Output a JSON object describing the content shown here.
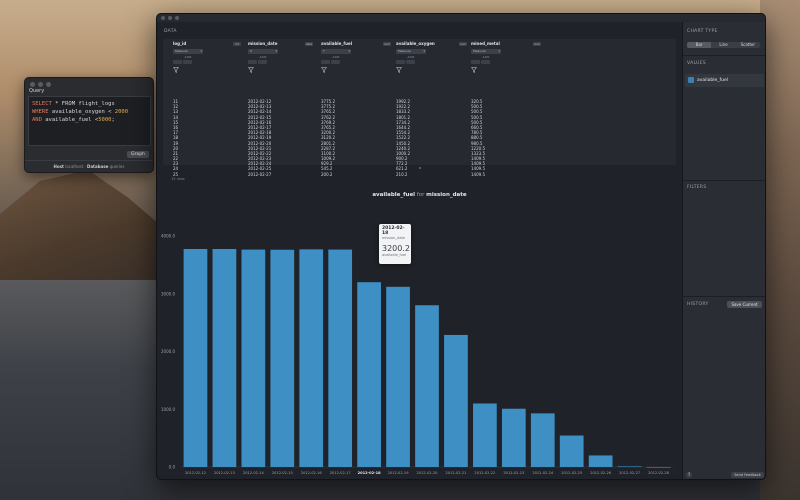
{
  "query_window": {
    "title": "Query",
    "sql_lines": [
      {
        "kw": "SELECT",
        "rest": " * FROM flight_logs"
      },
      {
        "kw": "WHERE",
        "rest": " available_oxygen < ",
        "num": "2000"
      },
      {
        "kw": "AND",
        "rest": " available_fuel <",
        "num": "5000",
        "tail": ";"
      }
    ],
    "graph_button": "Graph",
    "status": {
      "host_label": "Host",
      "host": "localhost",
      "sep": "·",
      "db_label": "Database",
      "db": "queries"
    }
  },
  "main": {
    "data_label": "DATA",
    "columns": [
      {
        "name": "log_id",
        "type": "int",
        "select": "Measure",
        "axis": "AXIS"
      },
      {
        "name": "mission_date",
        "type": "date",
        "select": "X",
        "axis": "AXIS"
      },
      {
        "name": "available_fuel",
        "type": "num",
        "select": "Y",
        "axis": "AXIS"
      },
      {
        "name": "available_oxygen",
        "type": "num",
        "select": "Measure",
        "axis": "AXIS"
      },
      {
        "name": "mined_metal",
        "type": "num",
        "select": "Measure",
        "axis": "AXIS"
      }
    ],
    "rows": [
      [
        "11",
        "2012-02-12",
        "3775.2",
        "1992.2",
        "320.5"
      ],
      [
        "12",
        "2012-02-13",
        "3775.2",
        "1922.2",
        "500.5"
      ],
      [
        "13",
        "2012-02-14",
        "3765.2",
        "1833.2",
        "500.5"
      ],
      [
        "14",
        "2012-02-15",
        "3762.2",
        "1801.2",
        "500.5"
      ],
      [
        "15",
        "2012-02-16",
        "3769.2",
        "1734.2",
        "500.5"
      ],
      [
        "16",
        "2012-02-17",
        "3765.2",
        "1644.2",
        "660.5"
      ],
      [
        "17",
        "2012-02-18",
        "3200.2",
        "1554.2",
        "780.5"
      ],
      [
        "18",
        "2012-02-19",
        "3120.2",
        "1522.2",
        "880.5"
      ],
      [
        "19",
        "2012-02-20",
        "2801.2",
        "1450.2",
        "980.5"
      ],
      [
        "20",
        "2012-02-21",
        "2287.2",
        "1240.2",
        "1220.5"
      ],
      [
        "21",
        "2012-02-22",
        "1100.2",
        "1000.2",
        "1323.5"
      ],
      [
        "22",
        "2012-02-23",
        "1009.2",
        "900.2",
        "1409.5"
      ],
      [
        "23",
        "2012-02-24",
        "929.2",
        "772.2",
        "1409.5"
      ],
      [
        "24",
        "2012-02-25",
        "545.2",
        "621.2",
        "1409.5"
      ],
      [
        "25",
        "2012-02-27",
        "200.2",
        "210.2",
        "1409.5"
      ]
    ],
    "row_count": "15 rows",
    "chart_title": {
      "y": "available_fuel",
      "for": "for",
      "x": "mission_date"
    },
    "tooltip": {
      "date": "2012-02-18",
      "date_label": "mission_date",
      "value": "3200.2",
      "value_label": "available_fuel"
    }
  },
  "chart_data": {
    "type": "bar",
    "categories": [
      "2012-02-12",
      "2012-02-13",
      "2012-02-14",
      "2012-02-15",
      "2012-02-16",
      "2012-02-17",
      "2012-02-18",
      "2012-02-19",
      "2012-02-20",
      "2012-02-21",
      "2012-02-22",
      "2012-02-23",
      "2012-02-24",
      "2012-02-25",
      "2012-02-26",
      "2012-02-27",
      "2012-02-28"
    ],
    "values": [
      3775,
      3775,
      3765,
      3762,
      3769,
      3765,
      3200,
      3120,
      2801,
      2287,
      1100,
      1009,
      929,
      545,
      200,
      10,
      0
    ],
    "ylim": [
      0,
      4000
    ],
    "yticks": [
      0,
      1000,
      2000,
      3000,
      4000
    ],
    "ytick_labels": [
      "0.0",
      "1000.0",
      "2000.0",
      "3000.0",
      "4000.0"
    ],
    "highlight_category": "2012-02-18",
    "bar_color": "#3d8fc4",
    "grid": false
  },
  "side": {
    "chart_type_label": "CHART TYPE",
    "chart_types": [
      "Bar",
      "Line",
      "Scatter"
    ],
    "active_type": "Bar",
    "values_label": "VALUES",
    "value_item": "available_fuel",
    "filters_label": "FILTERS",
    "history_label": "HISTORY",
    "save_button": "Save Current",
    "help": "?",
    "feedback_button": "Send Feedback"
  }
}
